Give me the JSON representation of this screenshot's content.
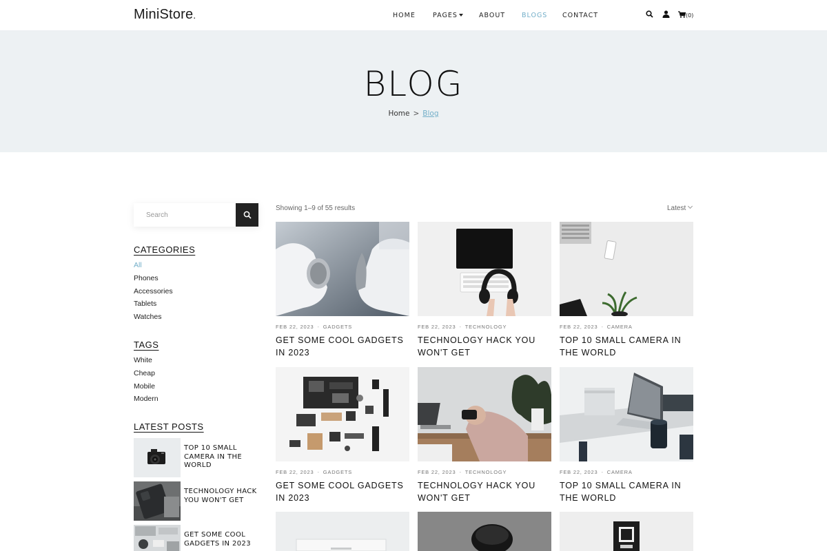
{
  "header": {
    "logo": "MiniStore",
    "nav": {
      "home": "HOME",
      "pages": "PAGES",
      "about": "ABOUT",
      "blogs": "BLOGS",
      "contact": "CONTACT"
    },
    "cart_count": "(0)",
    "icons": [
      "search-icon",
      "user-icon",
      "cart-icon"
    ],
    "accent_color": "#72aec8"
  },
  "hero": {
    "title": "BLOG",
    "breadcrumb": {
      "home": "Home",
      "separator": ">",
      "current": "Blog"
    },
    "background": "#edf1f3"
  },
  "sidebar": {
    "search_placeholder": "Search",
    "categories": {
      "heading": "CATEGORIES",
      "items": [
        "All",
        "Phones",
        "Accessories",
        "Tablets",
        "Watches"
      ],
      "active": "All"
    },
    "tags": {
      "heading": "TAGS",
      "items": [
        "White",
        "Cheap",
        "Mobile",
        "Modern"
      ]
    },
    "latest_posts": {
      "heading": "LATEST POSTS",
      "items": [
        {
          "title": "TOP 10 SMALL CAMERA IN THE WORLD"
        },
        {
          "title": "TECHNOLOGY HACK YOU WON'T GET"
        },
        {
          "title": "GET SOME COOL GADGETS IN 2023"
        }
      ]
    }
  },
  "main": {
    "results_text": "Showing 1–9 of 55 results",
    "sort_label": "Latest",
    "posts": [
      {
        "date": "FEB 22, 2023",
        "category": "GADGETS",
        "title": "GET SOME COOL GADGETS IN 2023"
      },
      {
        "date": "FEB 22, 2023",
        "category": "TECHNOLOGY",
        "title": "TECHNOLOGY HACK YOU WON'T GET"
      },
      {
        "date": "FEB 22, 2023",
        "category": "CAMERA",
        "title": "TOP 10 SMALL CAMERA IN THE WORLD"
      },
      {
        "date": "FEB 22, 2023",
        "category": "GADGETS",
        "title": "GET SOME COOL GADGETS IN 2023"
      },
      {
        "date": "FEB 22, 2023",
        "category": "TECHNOLOGY",
        "title": "TECHNOLOGY HACK YOU WON'T GET"
      },
      {
        "date": "FEB 22, 2023",
        "category": "CAMERA",
        "title": "TOP 10 SMALL CAMERA IN THE WORLD"
      }
    ],
    "meta_separator": "-"
  }
}
